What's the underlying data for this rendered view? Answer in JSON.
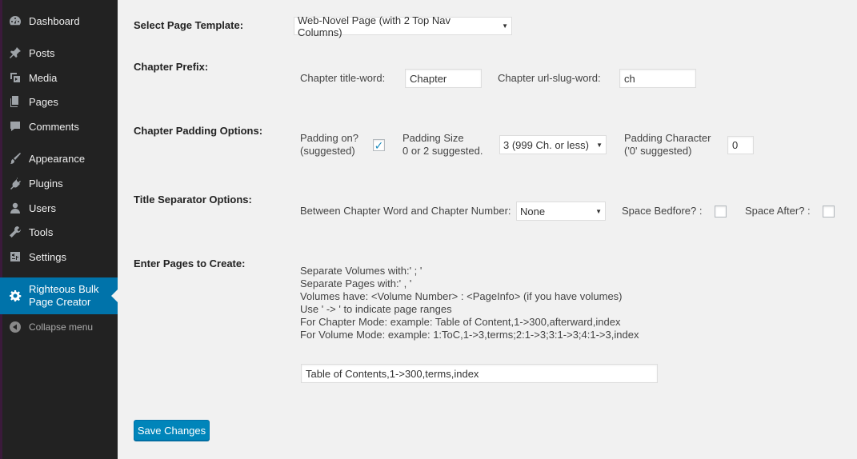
{
  "sidebar": {
    "items": [
      {
        "label": "Dashboard",
        "icon": "dashboard-icon"
      },
      {
        "label": "Posts",
        "icon": "pin-icon"
      },
      {
        "label": "Media",
        "icon": "media-icon"
      },
      {
        "label": "Pages",
        "icon": "pages-icon"
      },
      {
        "label": "Comments",
        "icon": "comment-icon"
      },
      {
        "label": "Appearance",
        "icon": "brush-icon"
      },
      {
        "label": "Plugins",
        "icon": "plug-icon"
      },
      {
        "label": "Users",
        "icon": "user-icon"
      },
      {
        "label": "Tools",
        "icon": "wrench-icon"
      },
      {
        "label": "Settings",
        "icon": "settings-icon"
      }
    ],
    "active": {
      "line1": "Righteous Bulk",
      "line2": "Page Creator",
      "icon": "gear-icon"
    },
    "collapse_label": "Collapse menu"
  },
  "form": {
    "template": {
      "label": "Select Page Template:",
      "value": "Web-Novel Page (with 2 Top Nav Columns)"
    },
    "prefix": {
      "label": "Chapter Prefix:",
      "title_word_label": "Chapter title-word:",
      "title_word_value": "Chapter",
      "slug_word_label": "Chapter url-slug-word:",
      "slug_word_value": "ch"
    },
    "padding": {
      "label": "Chapter Padding Options:",
      "on_label_1": "Padding on?",
      "on_label_2": "(suggested)",
      "on_checked": true,
      "size_label_1": "Padding Size",
      "size_label_2": "0 or 2 suggested.",
      "size_value": "3 (999 Ch. or less)",
      "char_label_1": "Padding Character",
      "char_label_2": "('0' suggested)",
      "char_value": "0"
    },
    "separator": {
      "label": "Title Separator Options:",
      "between_label": "Between Chapter Word and Chapter Number:",
      "between_value": "None",
      "space_before_label": "Space Bedfore? :",
      "space_after_label": "Space After? :"
    },
    "pages": {
      "label": "Enter Pages to Create:",
      "help": [
        "Separate Volumes with:' ; '",
        "Separate Pages with:' , '",
        "Volumes have: <Volume Number> : <PageInfo> (if you have volumes)",
        "Use ' -> ' to indicate page ranges",
        "For Chapter Mode: example: Table of Content,1->300,afterward,index",
        "For Volume Mode: example: 1:ToC,1->3,terms;2:1->3;3:1->3;4:1->3,index"
      ],
      "value": "Table of Contents,1->300,terms,index"
    },
    "save_label": "Save Changes"
  },
  "colors": {
    "accent": "#0073aa",
    "sidebar_bg": "#222222",
    "content_bg": "#f1f1f1"
  }
}
